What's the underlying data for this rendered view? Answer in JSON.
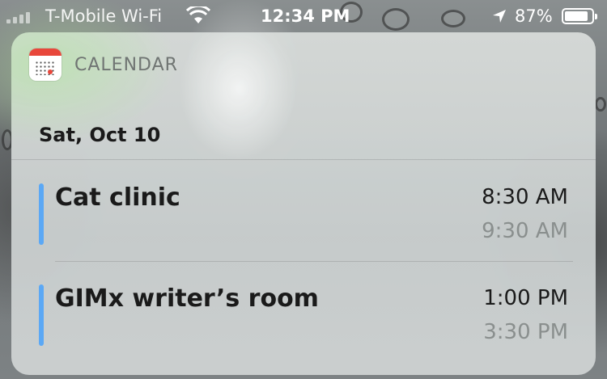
{
  "status_bar": {
    "carrier": "T-Mobile Wi-Fi",
    "time": "12:34 PM",
    "battery_percent": "87%",
    "battery_level": 0.87,
    "wifi_icon": "wifi-icon",
    "location_icon": "location-arrow-icon"
  },
  "widget": {
    "app_name": "CALENDAR",
    "app_icon": "calendar-app-icon",
    "date": "Sat, Oct 10",
    "accent_color": "#5ba8f5",
    "events": [
      {
        "title": "Cat clinic",
        "start": "8:30 AM",
        "end": "9:30 AM"
      },
      {
        "title": "GIMx writer’s room",
        "start": "1:00 PM",
        "end": "3:30 PM"
      }
    ]
  }
}
